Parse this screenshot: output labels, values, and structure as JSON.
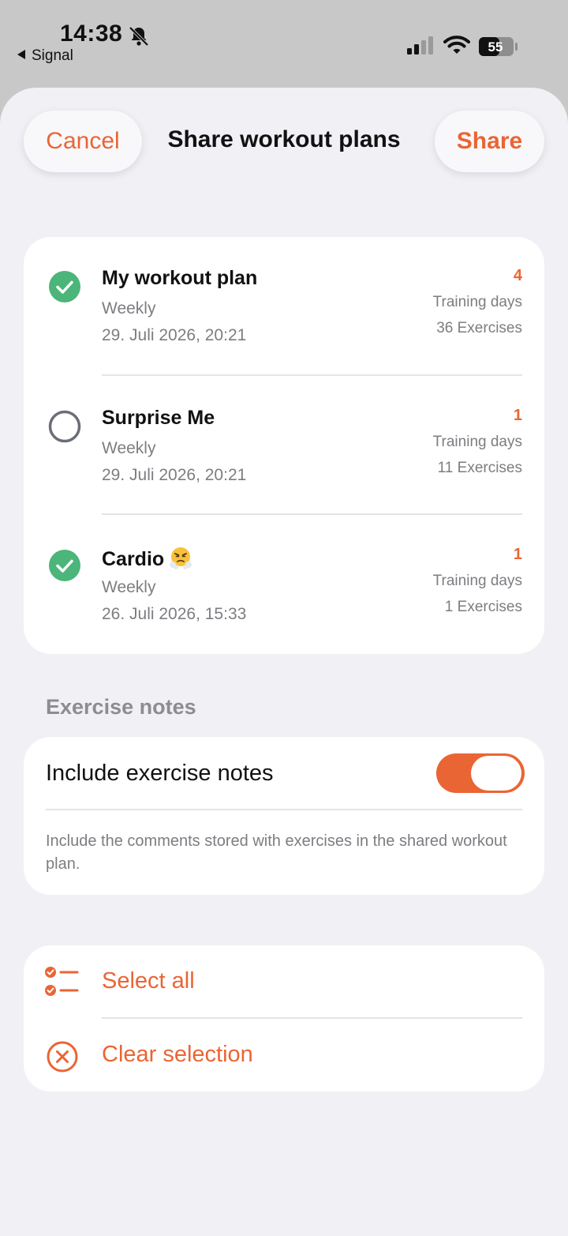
{
  "status_bar": {
    "time": "14:38",
    "back_app": "Signal",
    "battery": "55"
  },
  "header": {
    "cancel_label": "Cancel",
    "title": "Share workout plans",
    "share_label": "Share"
  },
  "colors": {
    "accent": "#ea6534",
    "check_green": "#4cb57a",
    "sheet_bg": "#f0f0f5"
  },
  "plans": [
    {
      "name": "My workout plan",
      "frequency": "Weekly",
      "date": "29. Juli 2026, 20:21",
      "days": "4",
      "days_label": "Training days",
      "exercises": "36 Exercises",
      "selected": true
    },
    {
      "name": "Surprise Me",
      "frequency": "Weekly",
      "date": "29. Juli 2026, 20:21",
      "days": "1",
      "days_label": "Training days",
      "exercises": "11 Exercises",
      "selected": false
    },
    {
      "name": "Cardio",
      "emoji": "face-with-steam-from-nose",
      "frequency": "Weekly",
      "date": "26. Juli 2026, 15:33",
      "days": "1",
      "days_label": "Training days",
      "exercises": "1 Exercises",
      "selected": true
    }
  ],
  "notes_section": {
    "heading": "Exercise notes",
    "toggle_label": "Include exercise notes",
    "toggle_on": true,
    "description": "Include the comments stored with exercises in the shared workout plan."
  },
  "actions": {
    "select_all": "Select all",
    "clear_selection": "Clear selection"
  }
}
